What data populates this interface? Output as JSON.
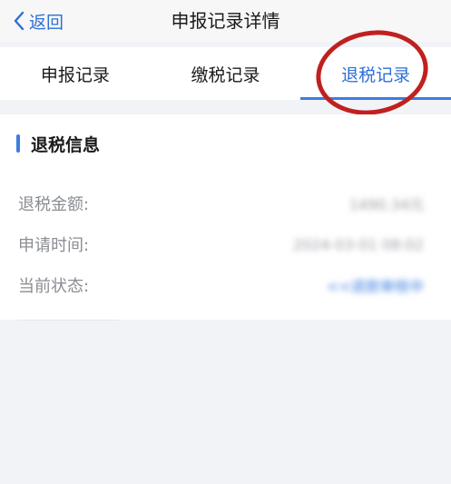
{
  "nav": {
    "back_label": "返回",
    "title": "申报记录详情"
  },
  "tabs": [
    {
      "label": "申报记录",
      "active": false
    },
    {
      "label": "缴税记录",
      "active": false
    },
    {
      "label": "退税记录",
      "active": true
    }
  ],
  "refund_info": {
    "section_title": "退税信息",
    "rows": [
      {
        "label": "退税金额:",
        "value": "1490.34元"
      },
      {
        "label": "申请时间:",
        "value": "2024-03-01 08:02"
      },
      {
        "label": "当前状态:",
        "value": "<<退款审核中"
      }
    ]
  },
  "colors": {
    "accent": "#3b7de0",
    "annotation": "#c0201f"
  }
}
